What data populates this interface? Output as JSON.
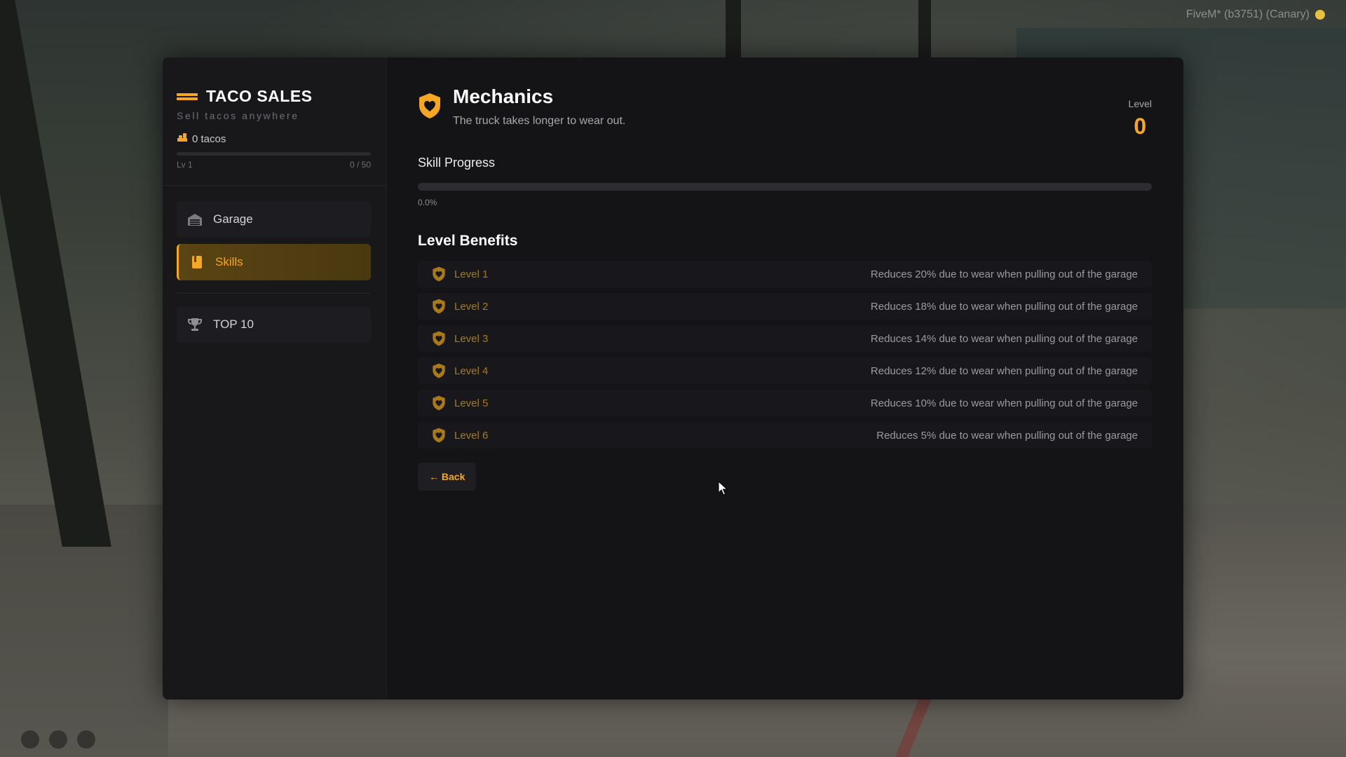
{
  "overlay": {
    "fivem_label": "FiveM* (b3751) (Canary)"
  },
  "sidebar": {
    "brand_title": "TACO SALES",
    "brand_subtitle": "Sell tacos anywhere",
    "tacos_count": "0 tacos",
    "level_label": "Lv 1",
    "level_progress_text": "0 / 50",
    "level_progress_fraction": 0,
    "nav": [
      {
        "label": "Garage",
        "icon": "garage-icon",
        "active": false
      },
      {
        "label": "Skills",
        "icon": "skills-book-icon",
        "active": true
      },
      {
        "label": "TOP 10",
        "icon": "trophy-icon",
        "active": false
      }
    ]
  },
  "skill": {
    "name": "Mechanics",
    "description": "The truck takes longer to wear out.",
    "icon": "shield-heart-icon",
    "level_label": "Level",
    "level_value": "0",
    "progress_title": "Skill Progress",
    "progress_percent": 0,
    "progress_text": "0.0%"
  },
  "benefits": {
    "title": "Level Benefits",
    "items": [
      {
        "level": "Level 1",
        "desc": "Reduces 20% due to wear when pulling out of the garage"
      },
      {
        "level": "Level 2",
        "desc": "Reduces 18% due to wear when pulling out of the garage"
      },
      {
        "level": "Level 3",
        "desc": "Reduces 14% due to wear when pulling out of the garage"
      },
      {
        "level": "Level 4",
        "desc": "Reduces 12% due to wear when pulling out of the garage"
      },
      {
        "level": "Level 5",
        "desc": "Reduces 10% due to wear when pulling out of the garage"
      },
      {
        "level": "Level 6",
        "desc": "Reduces 5% due to wear when pulling out of the garage"
      }
    ]
  },
  "actions": {
    "back_label": "← Back"
  },
  "colors": {
    "accent": "#f5a623",
    "panel_bg": "#141417",
    "sidebar_bg": "#18181b"
  }
}
